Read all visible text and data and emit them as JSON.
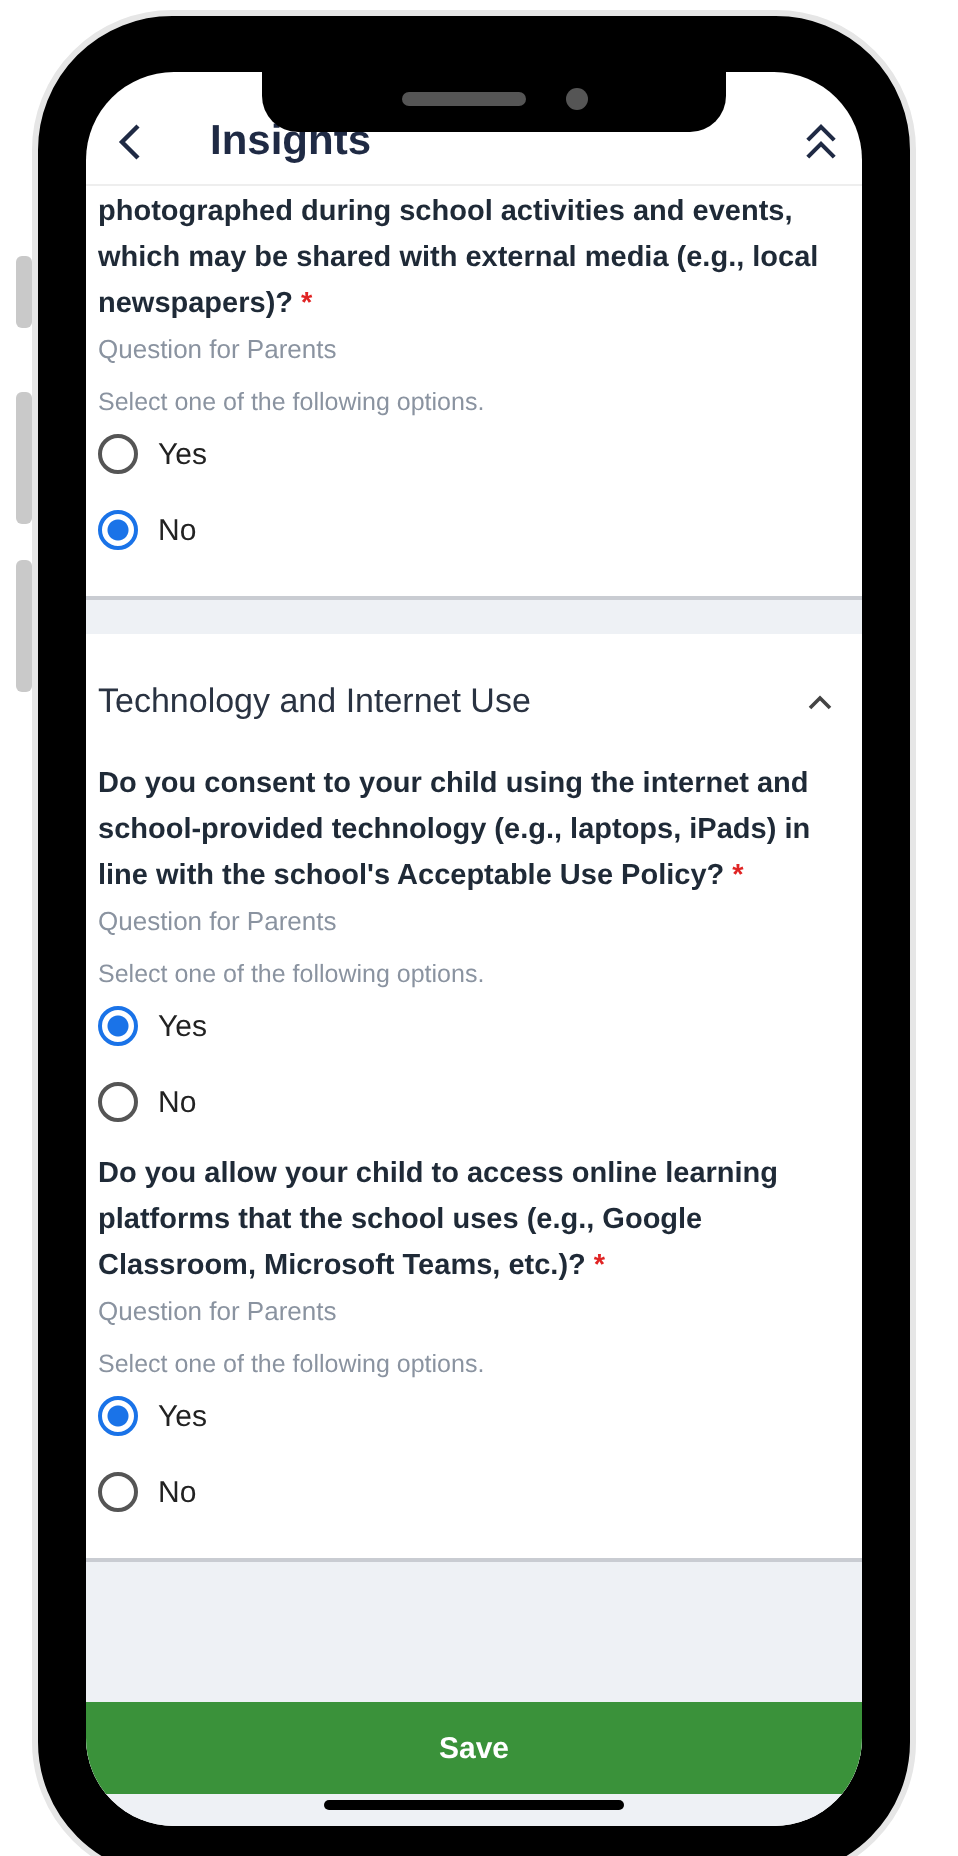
{
  "header": {
    "title": "Insights"
  },
  "cards": [
    {
      "questions": [
        {
          "text": "photographed during school activities and events, which may be shared with external media (e.g., local newspapers)?",
          "required_mark": "*",
          "audience": "Question for Parents",
          "instruction": "Select one of the following options.",
          "options": [
            {
              "label": "Yes",
              "selected": false
            },
            {
              "label": "No",
              "selected": true
            }
          ]
        }
      ]
    },
    {
      "heading": "Technology and Internet Use",
      "expanded": true,
      "questions": [
        {
          "text": "Do you consent to your child using the internet and school-provided technology (e.g., laptops, iPads) in line with the school's Acceptable Use Policy?",
          "required_mark": "*",
          "audience": "Question for Parents",
          "instruction": "Select one of the following options.",
          "options": [
            {
              "label": "Yes",
              "selected": true
            },
            {
              "label": "No",
              "selected": false
            }
          ]
        },
        {
          "text": "Do you allow your child to access online learning platforms that the school uses (e.g., Google Classroom, Microsoft Teams, etc.)?",
          "required_mark": "*",
          "audience": "Question for Parents",
          "instruction": "Select one of the following options.",
          "options": [
            {
              "label": "Yes",
              "selected": true
            },
            {
              "label": "No",
              "selected": false
            }
          ]
        }
      ]
    }
  ],
  "save_button": "Save"
}
